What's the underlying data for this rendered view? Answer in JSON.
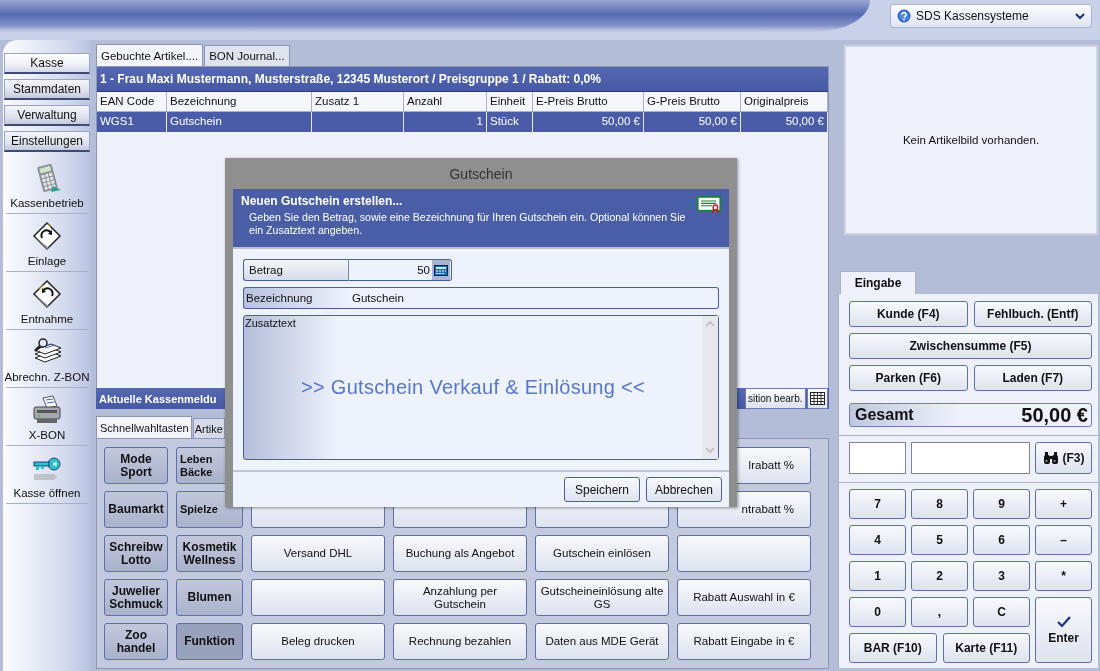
{
  "top_bar": {
    "company_menu": "SDS Kassensysteme"
  },
  "sidebar": {
    "sections": [
      {
        "label": "Kasse",
        "selected": true
      },
      {
        "label": "Stammdaten",
        "selected": false
      },
      {
        "label": "Verwaltung",
        "selected": false
      },
      {
        "label": "Einstellungen",
        "selected": false
      }
    ],
    "actions": [
      {
        "label": "Kassenbetrieb"
      },
      {
        "label": "Einlage"
      },
      {
        "label": "Entnahme"
      },
      {
        "label": "Abrechn. Z-BON"
      },
      {
        "label": "X-BON"
      },
      {
        "label": "Kasse öffnen"
      }
    ]
  },
  "article_tabs": [
    {
      "label": "Gebuchte Artikel....",
      "selected": true
    },
    {
      "label": "BON Journal...",
      "selected": false
    }
  ],
  "customer_bar": "1 - Frau Maxi Mustermann, Musterstraße, 12345 Musterort / Preisgruppe 1 / Rabatt: 0,0%",
  "table": {
    "columns": [
      "EAN Code",
      "Bezeichnung",
      "Zusatz 1",
      "Anzahl",
      "Einheit",
      "E-Preis Brutto",
      "G-Preis Brutto",
      "Originalpreis"
    ],
    "rows": [
      {
        "cells": [
          "WGS1",
          "Gutschein",
          null,
          "1",
          "Stück",
          "50,00 €",
          "50,00 €",
          "50,00 €"
        ],
        "selected": true
      }
    ]
  },
  "message_bar": {
    "title": "Aktuelle Kassenmeldu",
    "button": "sition bearb."
  },
  "quick_tabs": [
    {
      "label": "Schnellwahltasten",
      "selected": true
    },
    {
      "label": "Artike",
      "selected": false
    }
  ],
  "quick_keys": [
    [
      {
        "kind": "category",
        "label": "Mode\nSport",
        "selected": false
      },
      {
        "kind": "category",
        "label": "Leben\nBäcke",
        "selected": false
      },
      {
        "kind": "covered"
      },
      {
        "kind": "covered"
      },
      {
        "kind": "covered"
      },
      {
        "kind": "function",
        "label": "lrabatt %"
      }
    ],
    [
      {
        "kind": "category",
        "label": "Baumarkt",
        "selected": false
      },
      {
        "kind": "category",
        "label": "Spielze",
        "selected": false
      },
      {
        "kind": "function"
      },
      {
        "kind": "function"
      },
      {
        "kind": "function"
      },
      {
        "kind": "function",
        "label": "ntrabatt %"
      }
    ],
    [
      {
        "kind": "category",
        "label": "Schreibw\nLotto",
        "selected": false
      },
      {
        "kind": "category",
        "label": "Kosmetik\nWellness",
        "selected": false
      },
      {
        "kind": "function",
        "label": "Versand DHL"
      },
      {
        "kind": "function",
        "label": "Buchung als Angebot"
      },
      {
        "kind": "function",
        "label": "Gutschein einlösen"
      },
      {
        "kind": "function"
      }
    ],
    [
      {
        "kind": "category",
        "label": "Juwelier\nSchmuck",
        "selected": false
      },
      {
        "kind": "category",
        "label": "Blumen",
        "selected": false
      },
      {
        "kind": "function"
      },
      {
        "kind": "function",
        "label": "Anzahlung per Gutschein"
      },
      {
        "kind": "function",
        "label": "Gutscheineinlösung alte GS"
      },
      {
        "kind": "function",
        "label": "Rabatt Auswahl in €"
      }
    ],
    [
      {
        "kind": "category",
        "label": "Zoo\nhandel",
        "selected": false
      },
      {
        "kind": "category",
        "label": "Funktion",
        "selected": true
      },
      {
        "kind": "function",
        "label": "Beleg drucken"
      },
      {
        "kind": "function",
        "label": "Rechnung bezahlen"
      },
      {
        "kind": "function",
        "label": "Daten aus MDE Gerät"
      },
      {
        "kind": "function",
        "label": "Rabatt Eingabe in €"
      }
    ]
  ],
  "product_image": {
    "message": "Kein Artikelbild vorhanden."
  },
  "input_tab": {
    "label": "Eingabe"
  },
  "action_buttons": [
    {
      "label": "Kunde (F4)",
      "kind": "half"
    },
    {
      "label": "Fehlbuch. (Entf)",
      "kind": "half"
    },
    {
      "label": "Zwischensumme (F5)",
      "kind": "wide"
    },
    {
      "label": "Parken (F6)",
      "kind": "half"
    },
    {
      "label": "Laden (F7)",
      "kind": "half"
    }
  ],
  "total": {
    "label": "Gesamt",
    "value": "50,00 €"
  },
  "search_button": "(F3)",
  "keypad": [
    {
      "label": "7",
      "kind": "key"
    },
    {
      "label": "8",
      "kind": "key"
    },
    {
      "label": "9",
      "kind": "key"
    },
    {
      "label": "+",
      "kind": "key"
    },
    {
      "label": "4",
      "kind": "key"
    },
    {
      "label": "5",
      "kind": "key"
    },
    {
      "label": "6",
      "kind": "key"
    },
    {
      "label": "–",
      "kind": "key"
    },
    {
      "label": "1",
      "kind": "key"
    },
    {
      "label": "2",
      "kind": "key"
    },
    {
      "label": "3",
      "kind": "key"
    },
    {
      "label": "*",
      "kind": "key"
    },
    {
      "label": "0",
      "kind": "key"
    },
    {
      "label": ",",
      "kind": "key"
    },
    {
      "label": "C",
      "kind": "key"
    },
    {
      "label": "Enter",
      "kind": "enter"
    },
    {
      "label": "BAR (F10)",
      "kind": "payment"
    },
    {
      "label": "Karte (F11)",
      "kind": "payment"
    }
  ],
  "dialog": {
    "title": "Gutschein",
    "heading": "Neuen Gutschein erstellen...",
    "description": "Geben Sie den Betrag, sowie eine Bezeichnung für Ihren Gutschein ein. Optional können Sie ein Zusatztext angeben.",
    "amount": {
      "label": "Betrag",
      "value": "50"
    },
    "name": {
      "label": "Bezeichnung",
      "value": "Gutschein"
    },
    "note": {
      "label": "Zusatztext",
      "placeholder": ">> Gutschein Verkauf & Einlösung <<"
    },
    "buttons": [
      "Speichern",
      "Abbrechen"
    ]
  }
}
